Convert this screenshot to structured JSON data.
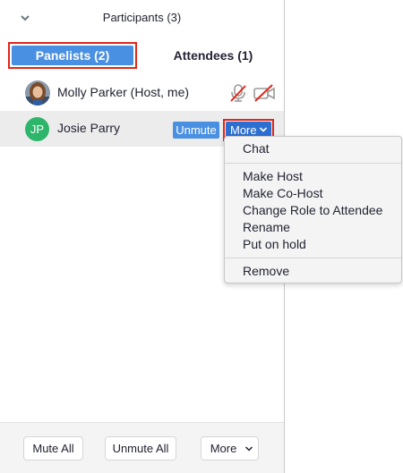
{
  "header": {
    "title": "Participants (3)",
    "collapse_icon": "chevron-down-icon"
  },
  "tabs": [
    {
      "label": "Panelists (2)",
      "selected": true
    },
    {
      "label": "Attendees (1)",
      "selected": false
    }
  ],
  "participants": [
    {
      "name": "Molly Parker (Host, me)",
      "avatar": "photo",
      "mic": "muted-mic-icon",
      "video": "video-off-icon"
    },
    {
      "name": "Josie Parry",
      "initials": "JP",
      "avatar_color": "#2db56a",
      "unmute_label": "Unmute",
      "more_label": "More"
    }
  ],
  "context_menu": {
    "groups": [
      [
        "Chat"
      ],
      [
        "Make Host",
        "Make Co-Host",
        "Change Role to Attendee",
        "Rename",
        "Put on hold"
      ],
      [
        "Remove"
      ]
    ]
  },
  "footer": {
    "mute_all": "Mute All",
    "unmute_all": "Unmute All",
    "more": "More"
  },
  "colors": {
    "accent": "#4a90e2",
    "highlight_border": "#e0271a",
    "muted_red": "#e0271a"
  }
}
